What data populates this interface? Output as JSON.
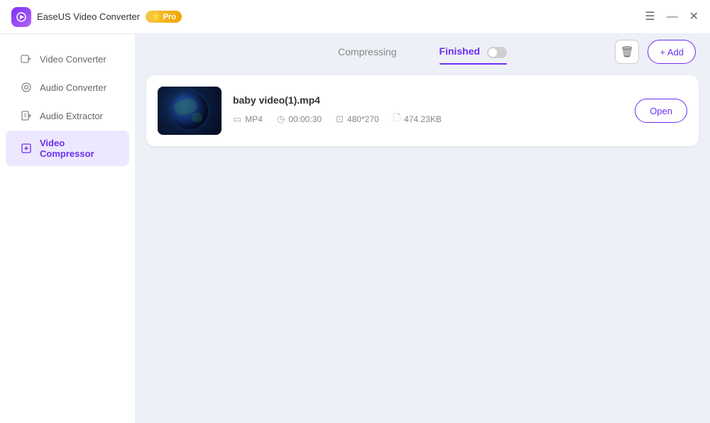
{
  "app": {
    "title": "EaseUS Video Converter",
    "pro_label": "Pro"
  },
  "title_bar": {
    "controls": {
      "menu": "☰",
      "minimize": "—",
      "close": "✕"
    }
  },
  "sidebar": {
    "items": [
      {
        "id": "video-converter",
        "label": "Video Converter",
        "icon": "video"
      },
      {
        "id": "audio-converter",
        "label": "Audio Converter",
        "icon": "audio"
      },
      {
        "id": "audio-extractor",
        "label": "Audio Extractor",
        "icon": "extract"
      },
      {
        "id": "video-compressor",
        "label": "Video Compressor",
        "icon": "compress",
        "active": true
      }
    ]
  },
  "tabs": {
    "compressing": {
      "label": "Compressing"
    },
    "finished": {
      "label": "Finished",
      "active": true
    }
  },
  "toolbar": {
    "trash_label": "🗑",
    "add_label": "+ Add"
  },
  "file_list": [
    {
      "name": "baby video(1).mp4",
      "format": "MP4",
      "duration": "00:00:30",
      "resolution": "480*270",
      "size": "474.23KB",
      "open_label": "Open"
    }
  ],
  "colors": {
    "accent": "#6b2ff0",
    "active_bg": "#ede8ff"
  }
}
